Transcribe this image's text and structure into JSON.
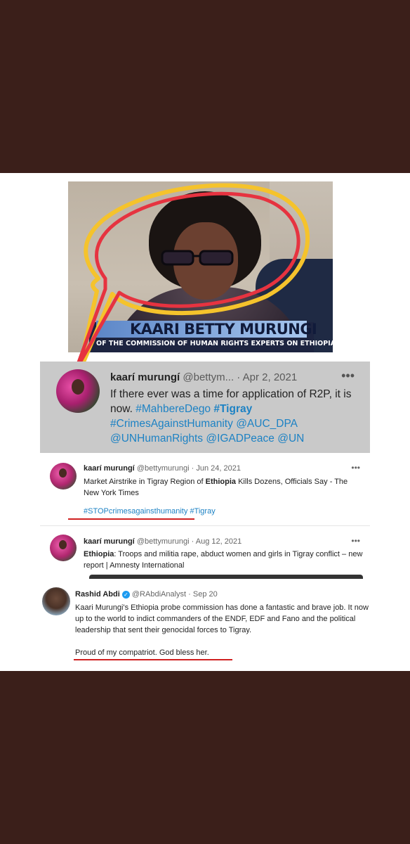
{
  "photo": {
    "name_caption": "KAARI BETTY MURUNGI",
    "role_caption": "OF THE COMMISSION OF HUMAN RIGHTS EXPERTS ON ETHIOPIA"
  },
  "tweet_main": {
    "display_name": "kaarí murungí",
    "handle": "@bettym...",
    "date": "· Apr 2, 2021",
    "more": "•••",
    "text_1": "If there ever was a time for application of R2P, it is now. ",
    "tag_1": "#MahbereDego",
    "tag_2": "#Tigray",
    "tag_3": "#CrimesAgainstHumanity",
    "mention_1": "@AUC_DPA",
    "mention_2": "@UNHumanRights",
    "mention_3": "@IGADPeace",
    "mention_4": "@UN"
  },
  "tweet_2": {
    "display_name": "kaarí murungí",
    "handle": "@bettymurungi",
    "date": "· Jun 24, 2021",
    "more": "•••",
    "text_a": "Market Airstrike in Tigray Region of ",
    "text_bold": "Ethiopia",
    "text_b": " Kills Dozens, Officials Say - The New York Times",
    "tag_1": "#STOPcrimesagainsthumanity",
    "tag_2": "#Tigray"
  },
  "tweet_3": {
    "display_name": "kaarí murungí",
    "handle": "@bettymurungi",
    "date": "· Aug 12, 2021",
    "more": "•••",
    "text_bold": "Ethiopia",
    "text_a": ": Troops and militia rape, abduct women and girls in Tigray conflict – new report | Amnesty International"
  },
  "tweet_4": {
    "display_name": "Rashid Abdi",
    "verified": "✓",
    "handle": "@RAbdiAnalyst",
    "date": "· Sep 20",
    "text_a": "Kaari Murungi's Ethiopia probe commission has done a fantastic and brave job. It now up to the world to indict commanders of the ENDF, EDF and Fano and the political leadership that sent their genocidal forces to Tigray.",
    "text_b": "Proud of my compatriot. God bless her."
  },
  "colors": {
    "background": "#3b1f1a",
    "link": "#1d82c4",
    "highlight_red": "#d02020",
    "highlight_yellow": "#f5c32c"
  }
}
